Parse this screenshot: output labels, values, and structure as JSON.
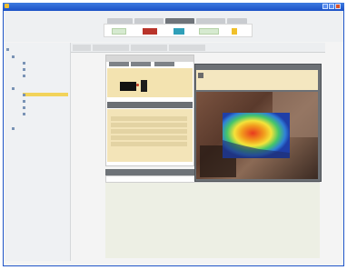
{
  "window": {
    "title": "",
    "colors": {
      "titlebar": "#1f55c8",
      "accent_yellow": "#f2d35a",
      "panel_beige": "#f3e4b8"
    }
  },
  "ribbon": {
    "tabs": [
      "",
      "",
      "",
      "",
      ""
    ],
    "active_tab_index": 2,
    "buttons": [
      "green-tool-icon",
      "red-tool-icon",
      "teal-tool-icon",
      "green-tool-icon",
      "yellow-tool-icon"
    ]
  },
  "tree": {
    "items": [
      {
        "label": "",
        "icon": "folder-icon",
        "indent": 0
      },
      {
        "label": "",
        "icon": "folder-icon",
        "indent": 1
      },
      {
        "label": "",
        "icon": "item-icon",
        "indent": 2
      },
      {
        "label": "",
        "icon": "item-icon",
        "indent": 2
      },
      {
        "label": "",
        "icon": "item-icon",
        "indent": 2
      },
      {
        "label": "",
        "icon": "folder-icon",
        "indent": 1
      },
      {
        "label": "",
        "icon": "item-icon",
        "indent": 2,
        "selected": true
      },
      {
        "label": "",
        "icon": "item-icon",
        "indent": 2
      },
      {
        "label": "",
        "icon": "item-icon",
        "indent": 2
      },
      {
        "label": "",
        "icon": "item-icon",
        "indent": 2
      },
      {
        "label": "",
        "icon": "folder-icon",
        "indent": 1
      }
    ]
  },
  "content": {
    "tabs": [
      "",
      "",
      "",
      ""
    ],
    "detail_tabs": [
      "",
      "",
      ""
    ],
    "section_header": "",
    "prop_rows": [
      "",
      "",
      "",
      "",
      ""
    ],
    "bottom_header": "",
    "bottom_sub": ""
  },
  "viewer": {
    "title": "",
    "info_lines": [
      "",
      "",
      ""
    ],
    "image_icon": "thermal-image"
  }
}
